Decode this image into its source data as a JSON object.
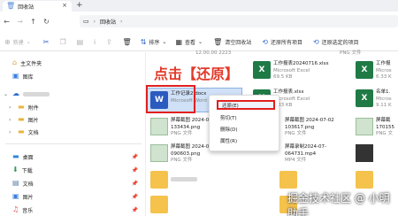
{
  "window": {
    "tab_title": "回收站",
    "new_tab": "+"
  },
  "address": {
    "location": "回收站"
  },
  "toolbar": {
    "new_label": "新建",
    "sort_label": "排序",
    "view_label": "查看",
    "empty_recycle_label": "清空回收站",
    "restore_all_label": "还原所有项目",
    "restore_selected_label": "还原选定的项目"
  },
  "sidebar": {
    "home_label": "主文件夹",
    "gallery_label": "图库",
    "attachments_label": "附件",
    "pictures_label": "图片",
    "documents_label": "文档",
    "desktop_label": "桌面",
    "downloads_label": "下载",
    "docs2_label": "文档",
    "pics2_label": "图片",
    "music_label": "音乐"
  },
  "files": {
    "top_sub": "12.00.00 2223",
    "top_png": "PNG 文件",
    "xlsx_name": "工作报表20240716.xlsx",
    "xlsx_type": "Microsoft Excel",
    "xlsx_size": "69.5 KB",
    "right1_type": "PNG 文",
    "right2_name": "工作报",
    "right2_type": "Micros",
    "right2_size": "6.33 K",
    "doc_name": "工作记录2.docx",
    "doc_type": "Microsoft Word",
    "xlsx2_name": "工作报表.xlsx",
    "xlsx2_type": "Microsoft Excel",
    "xlsx2_size": "6.33 KB",
    "right3_name": "名单1.",
    "right3_type": "Micros",
    "right3_size": "9.11 K",
    "shot1_name": "屏幕截图 2024-02",
    "shot1_sub": "133434.png",
    "shot1_type": "PNG 文件",
    "shot2_name": "屏幕截图 2024-07-02",
    "shot2_sub": "103617.png",
    "shot2_type": "PNG 文件",
    "right4_name": "屏幕截",
    "right4_sub": "170155",
    "right4_type": "PNG 文",
    "shot3_name": "屏幕截图 2024-02",
    "shot3_sub": "090603.png",
    "shot3_type": "PNG 文件",
    "video_name": "屏幕录制2024-07-",
    "video_sub": "064731.mp4",
    "video_type": "MP4 文件"
  },
  "context_menu": {
    "restore": "还原(E)",
    "cut": "剪切(T)",
    "delete": "删除(D)",
    "properties": "属性(R)"
  },
  "annotation": "点击【还原】",
  "watermark": "掘金技术社区 @ 小明助手"
}
